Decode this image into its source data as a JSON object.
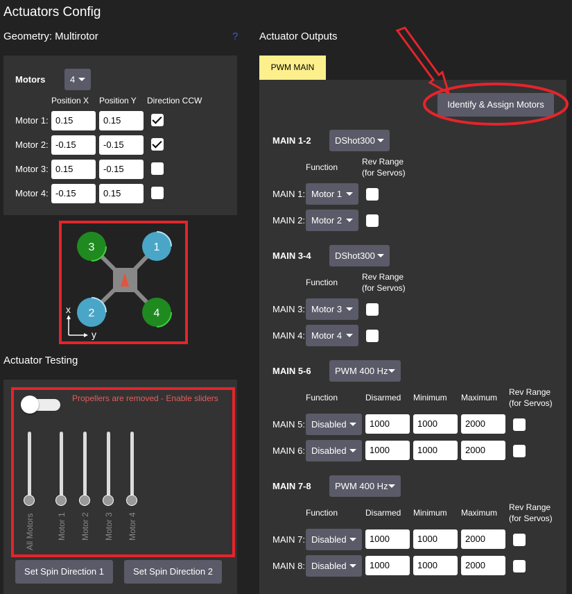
{
  "title": "Actuators Config",
  "geometry": {
    "title": "Geometry: Multirotor",
    "help_link": "?",
    "motors_label": "Motors",
    "motors_count": "4",
    "col_position_x": "Position X",
    "col_position_y": "Position Y",
    "col_direction": "Direction CCW",
    "motors": [
      {
        "label": "Motor 1:",
        "x": "0.15",
        "y": "0.15",
        "ccw": true
      },
      {
        "label": "Motor 2:",
        "x": "-0.15",
        "y": "-0.15",
        "ccw": true
      },
      {
        "label": "Motor 3:",
        "x": "0.15",
        "y": "-0.15",
        "ccw": false
      },
      {
        "label": "Motor 4:",
        "x": "-0.15",
        "y": "0.15",
        "ccw": false
      }
    ]
  },
  "diagram": {
    "rotors": [
      "1",
      "2",
      "3",
      "4"
    ],
    "axis_x": "x",
    "axis_y": "y",
    "colors": {
      "cw": "#4aa6c7",
      "ccw": "#1f8a20",
      "frame": "#888888",
      "heading": "#e05540"
    }
  },
  "testing": {
    "title": "Actuator Testing",
    "warning": "Propellers are removed - Enable sliders",
    "sliders": [
      {
        "label": "All Motors",
        "value": 0
      },
      {
        "label": "Motor 1",
        "value": 0
      },
      {
        "label": "Motor 2",
        "value": 0
      },
      {
        "label": "Motor 3",
        "value": 0
      },
      {
        "label": "Motor 4",
        "value": 0
      }
    ],
    "btn_spin1": "Set Spin Direction 1",
    "btn_spin2": "Set Spin Direction 2"
  },
  "outputs": {
    "title": "Actuator Outputs",
    "tab": "PWM MAIN",
    "identify_button": "Identify & Assign Motors",
    "col_function": "Function",
    "col_rev_range": "Rev Range",
    "col_rev_range2": "(for Servos)",
    "col_disarmed": "Disarmed",
    "col_minimum": "Minimum",
    "col_maximum": "Maximum",
    "groups": [
      {
        "label": "MAIN 1-2",
        "protocol": "DShot300",
        "channels": [
          {
            "label": "MAIN 1:",
            "function": "Motor 1"
          },
          {
            "label": "MAIN 2:",
            "function": "Motor 2"
          }
        ]
      },
      {
        "label": "MAIN 3-4",
        "protocol": "DShot300",
        "channels": [
          {
            "label": "MAIN 3:",
            "function": "Motor 3"
          },
          {
            "label": "MAIN 4:",
            "function": "Motor 4"
          }
        ]
      },
      {
        "label": "MAIN 5-6",
        "protocol": "PWM 400 Hz",
        "channels": [
          {
            "label": "MAIN 5:",
            "function": "Disabled",
            "disarmed": "1000",
            "minimum": "1000",
            "maximum": "2000"
          },
          {
            "label": "MAIN 6:",
            "function": "Disabled",
            "disarmed": "1000",
            "minimum": "1000",
            "maximum": "2000"
          }
        ]
      },
      {
        "label": "MAIN 7-8",
        "protocol": "PWM 400 Hz",
        "channels": [
          {
            "label": "MAIN 7:",
            "function": "Disabled",
            "disarmed": "1000",
            "minimum": "1000",
            "maximum": "2000"
          },
          {
            "label": "MAIN 8:",
            "function": "Disabled",
            "disarmed": "1000",
            "minimum": "1000",
            "maximum": "2000"
          }
        ]
      }
    ]
  },
  "colors": {
    "accent_tab": "#fdf08c",
    "highlight": "#e5242b",
    "warning_text": "#e65c5c"
  }
}
